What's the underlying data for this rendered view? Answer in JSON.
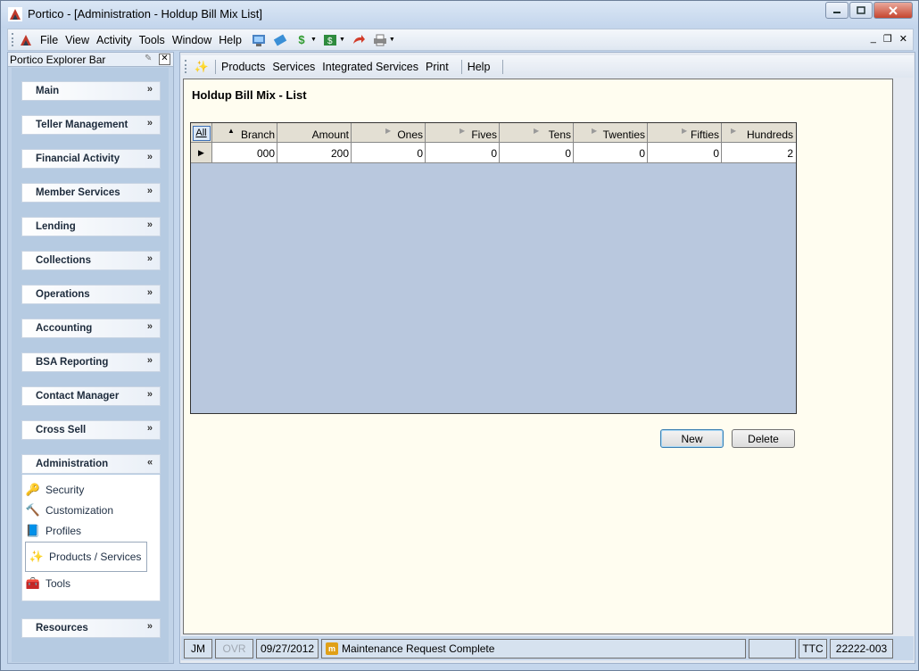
{
  "window": {
    "title": "Portico - [Administration - Holdup Bill Mix List]",
    "minimize": "0",
    "maximize": "1",
    "close": "r"
  },
  "menubar": {
    "items": [
      "File",
      "View",
      "Activity",
      "Tools",
      "Window",
      "Help"
    ],
    "mdi_controls": [
      "_",
      "❐",
      "✕"
    ]
  },
  "explorer": {
    "title": "Portico Explorer Bar",
    "groups": [
      {
        "label": "Main"
      },
      {
        "label": "Teller Management"
      },
      {
        "label": "Financial Activity"
      },
      {
        "label": "Member Services"
      },
      {
        "label": "Lending"
      },
      {
        "label": "Collections"
      },
      {
        "label": "Operations"
      },
      {
        "label": "Accounting"
      },
      {
        "label": "BSA Reporting"
      },
      {
        "label": "Contact Manager"
      },
      {
        "label": "Cross Sell"
      },
      {
        "label": "Administration"
      },
      {
        "label": "Resources"
      }
    ],
    "admin_items": [
      {
        "label": "Security",
        "icon": "security-icon"
      },
      {
        "label": "Customization",
        "icon": "customization-icon"
      },
      {
        "label": "Profiles",
        "icon": "profiles-icon"
      },
      {
        "label": "Products / Services",
        "icon": "products-services-icon"
      },
      {
        "label": "Tools",
        "icon": "tools-icon"
      }
    ]
  },
  "main_toolbar": {
    "items": [
      "Products",
      "Services",
      "Integrated Services",
      "Print",
      "Help"
    ]
  },
  "page": {
    "title": "Holdup Bill Mix - List"
  },
  "grid": {
    "select_all": "All",
    "columns": [
      "Branch",
      "Amount",
      "Ones",
      "Fives",
      "Tens",
      "Twenties",
      "Fifties",
      "Hundreds"
    ],
    "rows": [
      [
        "000",
        "200",
        "0",
        "0",
        "0",
        "0",
        "0",
        "2"
      ]
    ]
  },
  "buttons": {
    "new": "New",
    "delete": "Delete"
  },
  "statusbar": {
    "user": "JM",
    "ovr": "OVR",
    "date": "09/27/2012",
    "message": "Maintenance Request Complete",
    "ttc": "TTC",
    "branch_code": "22222-003"
  }
}
